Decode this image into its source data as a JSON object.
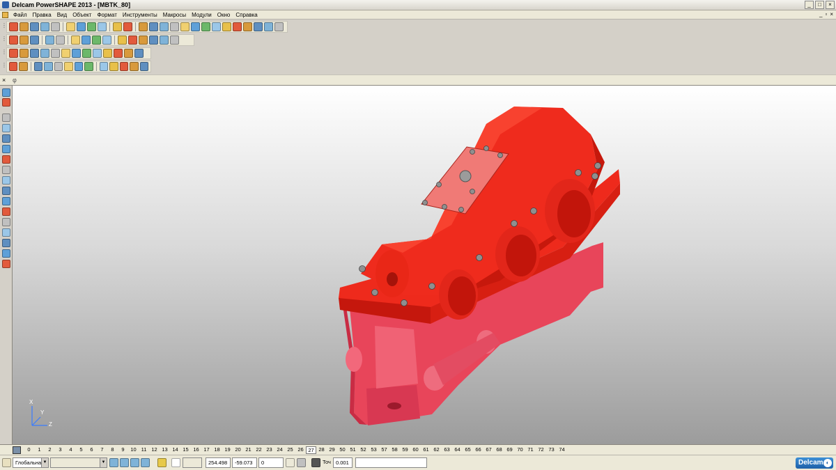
{
  "window": {
    "title": "Delcam PowerSHAPE 2013 - [MBTK_80]",
    "minimize": "_",
    "maximize": "□",
    "close": "×"
  },
  "menu": {
    "items": [
      "Файл",
      "Правка",
      "Вид",
      "Объект",
      "Формат",
      "Инструменты",
      "Макросы",
      "Модули",
      "Окно",
      "Справка"
    ],
    "mdi_minimize": "_",
    "mdi_restore": "▫",
    "mdi_close": "×"
  },
  "prompt_bar": {
    "close": "×",
    "symbol": "φ"
  },
  "viewport": {
    "axes": {
      "x": "X",
      "y": "Y",
      "z": "Z"
    },
    "model_color": "#ee2a1c"
  },
  "levels": {
    "numbers": [
      "0",
      "1",
      "2",
      "3",
      "4",
      "5",
      "6",
      "7",
      "8",
      "9",
      "10",
      "11",
      "12",
      "13",
      "14",
      "15",
      "16",
      "17",
      "18",
      "19",
      "20",
      "21",
      "22",
      "23",
      "24",
      "25",
      "26",
      "27",
      "28",
      "29",
      "50",
      "51",
      "52",
      "53",
      "57",
      "58",
      "59",
      "60",
      "61",
      "62",
      "63",
      "64",
      "65",
      "66",
      "67",
      "68",
      "69",
      "70",
      "71",
      "72",
      "73",
      "74"
    ],
    "active": "27"
  },
  "status": {
    "workplane": "Глобальна",
    "coord_x": "254.498",
    "coord_y": "-59.073",
    "coord_z": "0",
    "tolerance_label": "Точ",
    "tolerance_value": "0.001",
    "logo_text": "Delcam"
  }
}
